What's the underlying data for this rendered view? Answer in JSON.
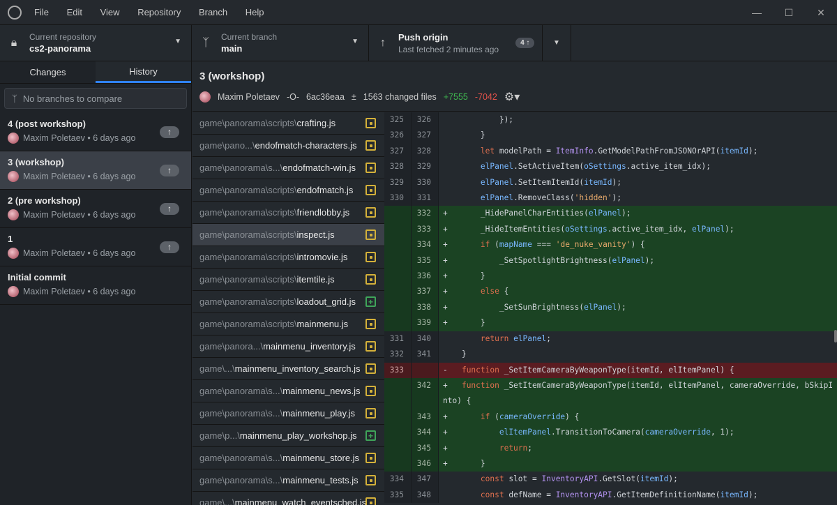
{
  "menu": [
    "File",
    "Edit",
    "View",
    "Repository",
    "Branch",
    "Help"
  ],
  "window_controls": [
    "minimize",
    "maximize",
    "close"
  ],
  "toolbar": {
    "repo": {
      "label": "Current repository",
      "value": "cs2-panorama"
    },
    "branch": {
      "label": "Current branch",
      "value": "main"
    },
    "push": {
      "label": "Push origin",
      "sub": "Last fetched 2 minutes ago",
      "badge": "4 ↑"
    }
  },
  "sidebar": {
    "tabs": [
      "Changes",
      "History"
    ],
    "active_tab": "History",
    "compare_placeholder": "No branches to compare",
    "commits": [
      {
        "title": "4 (post workshop)",
        "meta": "Maxim Poletaev • 6 days ago",
        "unpushed": true
      },
      {
        "title": "3 (workshop)",
        "meta": "Maxim Poletaev • 6 days ago",
        "unpushed": true,
        "selected": true
      },
      {
        "title": "2 (pre workshop)",
        "meta": "Maxim Poletaev • 6 days ago",
        "unpushed": true
      },
      {
        "title": "1",
        "meta": "Maxim Poletaev • 6 days ago",
        "unpushed": true
      },
      {
        "title": "Initial commit",
        "meta": "Maxim Poletaev • 6 days ago",
        "unpushed": false
      }
    ]
  },
  "commit": {
    "title": "3 (workshop)",
    "author": "Maxim Poletaev",
    "sha": "6ac36eaa",
    "changed": "1563 changed files",
    "additions": "+7555",
    "deletions": "-7042"
  },
  "files": [
    {
      "dir": "game\\panorama\\scripts\\",
      "name": "crafting.js",
      "status": "modified"
    },
    {
      "dir": "game\\pano...\\",
      "name": "endofmatch-characters.js",
      "status": "modified"
    },
    {
      "dir": "game\\panorama\\s...\\",
      "name": "endofmatch-win.js",
      "status": "modified"
    },
    {
      "dir": "game\\panorama\\scripts\\",
      "name": "endofmatch.js",
      "status": "modified"
    },
    {
      "dir": "game\\panorama\\scripts\\",
      "name": "friendlobby.js",
      "status": "modified"
    },
    {
      "dir": "game\\panorama\\scripts\\",
      "name": "inspect.js",
      "status": "modified",
      "selected": true
    },
    {
      "dir": "game\\panorama\\scripts\\",
      "name": "intromovie.js",
      "status": "modified"
    },
    {
      "dir": "game\\panorama\\scripts\\",
      "name": "itemtile.js",
      "status": "modified"
    },
    {
      "dir": "game\\panorama\\scripts\\",
      "name": "loadout_grid.js",
      "status": "added"
    },
    {
      "dir": "game\\panorama\\scripts\\",
      "name": "mainmenu.js",
      "status": "modified"
    },
    {
      "dir": "game\\panora...\\",
      "name": "mainmenu_inventory.js",
      "status": "modified"
    },
    {
      "dir": "game\\...\\",
      "name": "mainmenu_inventory_search.js",
      "status": "modified"
    },
    {
      "dir": "game\\panorama\\s...\\",
      "name": "mainmenu_news.js",
      "status": "modified"
    },
    {
      "dir": "game\\panorama\\s...\\",
      "name": "mainmenu_play.js",
      "status": "modified"
    },
    {
      "dir": "game\\p...\\",
      "name": "mainmenu_play_workshop.js",
      "status": "added"
    },
    {
      "dir": "game\\panorama\\s...\\",
      "name": "mainmenu_store.js",
      "status": "modified"
    },
    {
      "dir": "game\\panorama\\s...\\",
      "name": "mainmenu_tests.js",
      "status": "modified"
    },
    {
      "dir": "game\\...\\",
      "name": "mainmenu_watch_eventsched.js",
      "status": "modified"
    }
  ],
  "diff": [
    {
      "old": "325",
      "new": "326",
      "type": "ctx",
      "tokens": [
        [
          "        });",
          ""
        ]
      ]
    },
    {
      "old": "326",
      "new": "327",
      "type": "ctx",
      "tokens": [
        [
          "    }",
          ""
        ]
      ]
    },
    {
      "old": "327",
      "new": "328",
      "type": "ctx",
      "tokens": [
        [
          "    ",
          ""
        ],
        [
          "let",
          "kw"
        ],
        [
          " modelPath = ",
          ""
        ],
        [
          "ItemInfo",
          "cls"
        ],
        [
          ".GetModelPathFromJSONOrAPI(",
          ""
        ],
        [
          "itemId",
          "id"
        ],
        [
          ");",
          ""
        ]
      ]
    },
    {
      "old": "328",
      "new": "329",
      "type": "ctx",
      "tokens": [
        [
          "    ",
          ""
        ],
        [
          "elPanel",
          "id"
        ],
        [
          ".SetActiveItem(",
          ""
        ],
        [
          "oSettings",
          "id"
        ],
        [
          ".active_item_idx);",
          ""
        ]
      ]
    },
    {
      "old": "329",
      "new": "330",
      "type": "ctx",
      "tokens": [
        [
          "    ",
          ""
        ],
        [
          "elPanel",
          "id"
        ],
        [
          ".SetItemItemId(",
          ""
        ],
        [
          "itemId",
          "id"
        ],
        [
          ");",
          ""
        ]
      ]
    },
    {
      "old": "330",
      "new": "331",
      "type": "ctx",
      "tokens": [
        [
          "    ",
          ""
        ],
        [
          "elPanel",
          "id"
        ],
        [
          ".RemoveClass(",
          ""
        ],
        [
          "'hidden'",
          "str"
        ],
        [
          ");",
          ""
        ]
      ]
    },
    {
      "old": "",
      "new": "332",
      "type": "add",
      "tokens": [
        [
          "    _HidePanelCharEntities(",
          ""
        ],
        [
          "elPanel",
          "id"
        ],
        [
          ");",
          ""
        ]
      ]
    },
    {
      "old": "",
      "new": "333",
      "type": "add",
      "tokens": [
        [
          "    _HideItemEntities(",
          ""
        ],
        [
          "oSettings",
          "id"
        ],
        [
          ".active_item_idx, ",
          ""
        ],
        [
          "elPanel",
          "id"
        ],
        [
          ");",
          ""
        ]
      ]
    },
    {
      "old": "",
      "new": "334",
      "type": "add",
      "tokens": [
        [
          "    ",
          ""
        ],
        [
          "if",
          "kw"
        ],
        [
          " (",
          ""
        ],
        [
          "mapName",
          "id"
        ],
        [
          " === ",
          ""
        ],
        [
          "'de_nuke_vanity'",
          "str"
        ],
        [
          ") {",
          ""
        ]
      ]
    },
    {
      "old": "",
      "new": "335",
      "type": "add",
      "tokens": [
        [
          "        _SetSpotlightBrightness(",
          ""
        ],
        [
          "elPanel",
          "id"
        ],
        [
          ");",
          ""
        ]
      ]
    },
    {
      "old": "",
      "new": "336",
      "type": "add",
      "tokens": [
        [
          "    }",
          ""
        ]
      ]
    },
    {
      "old": "",
      "new": "337",
      "type": "add",
      "tokens": [
        [
          "    ",
          ""
        ],
        [
          "else",
          "kw"
        ],
        [
          " {",
          ""
        ]
      ]
    },
    {
      "old": "",
      "new": "338",
      "type": "add",
      "tokens": [
        [
          "        _SetSunBrightness(",
          ""
        ],
        [
          "elPanel",
          "id"
        ],
        [
          ");",
          ""
        ]
      ]
    },
    {
      "old": "",
      "new": "339",
      "type": "add",
      "tokens": [
        [
          "    }",
          ""
        ]
      ]
    },
    {
      "old": "331",
      "new": "340",
      "type": "ctx",
      "tokens": [
        [
          "    ",
          ""
        ],
        [
          "return",
          "kw"
        ],
        [
          " ",
          ""
        ],
        [
          "elPanel",
          "id"
        ],
        [
          ";",
          ""
        ]
      ]
    },
    {
      "old": "332",
      "new": "341",
      "type": "ctx",
      "tokens": [
        [
          "}",
          ""
        ]
      ]
    },
    {
      "old": "333",
      "new": "",
      "type": "del",
      "tokens": [
        [
          "function",
          "kw"
        ],
        [
          " _SetItemCameraByWeaponType(itemId, elItemPanel) {",
          ""
        ]
      ]
    },
    {
      "old": "",
      "new": "342",
      "type": "add",
      "tokens": [
        [
          "function",
          "kw"
        ],
        [
          " _SetItemCameraByWeaponType(itemId, elItemPanel, cameraOverride, bSkipInto) {",
          ""
        ]
      ]
    },
    {
      "old": "",
      "new": "343",
      "type": "add",
      "tokens": [
        [
          "    ",
          ""
        ],
        [
          "if",
          "kw"
        ],
        [
          " (",
          ""
        ],
        [
          "cameraOverride",
          "id"
        ],
        [
          ") {",
          ""
        ]
      ]
    },
    {
      "old": "",
      "new": "344",
      "type": "add",
      "tokens": [
        [
          "        ",
          ""
        ],
        [
          "elItemPanel",
          "id"
        ],
        [
          ".TransitionToCamera(",
          ""
        ],
        [
          "cameraOverride",
          "id"
        ],
        [
          ", 1);",
          ""
        ]
      ]
    },
    {
      "old": "",
      "new": "345",
      "type": "add",
      "tokens": [
        [
          "        ",
          ""
        ],
        [
          "return",
          "kw"
        ],
        [
          ";",
          ""
        ]
      ]
    },
    {
      "old": "",
      "new": "346",
      "type": "add",
      "tokens": [
        [
          "    }",
          ""
        ]
      ]
    },
    {
      "old": "334",
      "new": "347",
      "type": "ctx",
      "tokens": [
        [
          "    ",
          ""
        ],
        [
          "const",
          "kw"
        ],
        [
          " slot = ",
          ""
        ],
        [
          "InventoryAPI",
          "cls"
        ],
        [
          ".GetSlot(",
          ""
        ],
        [
          "itemId",
          "id"
        ],
        [
          ");",
          ""
        ]
      ]
    },
    {
      "old": "335",
      "new": "348",
      "type": "ctx",
      "tokens": [
        [
          "    ",
          ""
        ],
        [
          "const",
          "kw"
        ],
        [
          " defName = ",
          ""
        ],
        [
          "InventoryAPI",
          "cls"
        ],
        [
          ".GetItemDefinitionName(",
          ""
        ],
        [
          "itemId",
          "id"
        ],
        [
          ");",
          ""
        ]
      ]
    }
  ],
  "colors": {
    "accent": "#2f81f7",
    "added": "#1b4323",
    "deleted": "#5b1c21",
    "modified_status": "#d4b13a",
    "added_status": "#3fa55a"
  }
}
